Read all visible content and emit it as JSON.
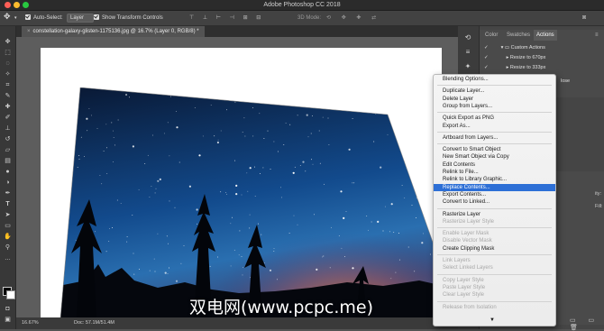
{
  "app": {
    "title": "Adobe Photoshop CC 2018"
  },
  "options_bar": {
    "auto_select_label": "Auto-Select:",
    "auto_select_value": "Layer",
    "transform_controls_label": "Show Transform Controls",
    "mode_3d_label": "3D Mode:"
  },
  "document": {
    "tab_title": "constellation-galaxy-glisten-1175136.jpg @ 16.7% (Layer 0, RGB/8) *",
    "zoom": "16.67%",
    "doc_size": "Doc: 57.1M/51.4M"
  },
  "panel": {
    "tabs": [
      "Color",
      "Swatches",
      "Actions"
    ],
    "active_tab": "Actions",
    "rows": [
      "Custom Actions",
      "Resize to 670px",
      "Resize to 333px"
    ],
    "partial_label": "lose",
    "opacity_label": "ity:",
    "fill_label": "Fill:"
  },
  "context_menu": {
    "items": [
      {
        "label": "Blending Options...",
        "enabled": true
      },
      {
        "label": "Duplicate Layer...",
        "enabled": true
      },
      {
        "label": "Delete Layer",
        "enabled": true
      },
      {
        "label": "Group from Layers...",
        "enabled": true
      },
      {
        "label": "Quick Export as PNG",
        "enabled": true
      },
      {
        "label": "Export As...",
        "enabled": true
      },
      {
        "label": "Artboard from Layers...",
        "enabled": true
      },
      {
        "label": "Convert to Smart Object",
        "enabled": true
      },
      {
        "label": "New Smart Object via Copy",
        "enabled": true
      },
      {
        "label": "Edit Contents",
        "enabled": true
      },
      {
        "label": "Relink to File...",
        "enabled": true
      },
      {
        "label": "Relink to Library Graphic...",
        "enabled": true
      },
      {
        "label": "Replace Contents...",
        "enabled": true,
        "highlighted": true
      },
      {
        "label": "Export Contents...",
        "enabled": true
      },
      {
        "label": "Convert to Linked...",
        "enabled": true
      },
      {
        "label": "Rasterize Layer",
        "enabled": true
      },
      {
        "label": "Rasterize Layer Style",
        "enabled": false
      },
      {
        "label": "Enable Layer Mask",
        "enabled": false
      },
      {
        "label": "Disable Vector Mask",
        "enabled": false
      },
      {
        "label": "Create Clipping Mask",
        "enabled": true
      },
      {
        "label": "Link Layers",
        "enabled": false
      },
      {
        "label": "Select Linked Layers",
        "enabled": false
      },
      {
        "label": "Copy Layer Style",
        "enabled": false
      },
      {
        "label": "Paste Layer Style",
        "enabled": false
      },
      {
        "label": "Clear Layer Style",
        "enabled": false
      },
      {
        "label": "Release from Isolation",
        "enabled": false
      }
    ]
  },
  "watermark": "双电网(www.pcpc.me)",
  "colors": {
    "highlight": "#2d6fd6",
    "sky_top": "#0a1c45",
    "sky_bottom": "#1d5fa8",
    "glow": "#e0703a"
  },
  "tool_icons": [
    "move-icon",
    "marquee-icon",
    "lasso-icon",
    "magic-wand-icon",
    "crop-icon",
    "eyedropper-icon",
    "healing-brush-icon",
    "brush-icon",
    "clone-stamp-icon",
    "history-brush-icon",
    "eraser-icon",
    "gradient-icon",
    "blur-icon",
    "dodge-icon",
    "pen-icon",
    "type-icon",
    "path-select-icon",
    "shape-icon",
    "hand-icon",
    "zoom-icon"
  ]
}
